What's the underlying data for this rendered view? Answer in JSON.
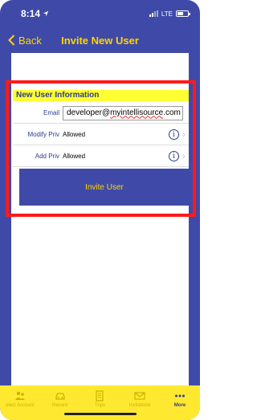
{
  "status_bar": {
    "time": "8:14",
    "network": "LTE"
  },
  "nav": {
    "back_label": "Back",
    "title": "Invite New User"
  },
  "form": {
    "section_title": "New User Information",
    "email_label": "Email",
    "email_value": "developer@myintellisource.com",
    "email_user": "developer@",
    "email_domain": "myintellisource",
    "email_tld": ".com",
    "modify_priv_label": "Modify Priv",
    "modify_priv_value": "Allowed",
    "add_priv_label": "Add Priv",
    "add_priv_value": "Allowed",
    "info_glyph": "i"
  },
  "invite_button": {
    "label": "Invite User"
  },
  "tabs": [
    {
      "label": "elect Account",
      "icon": "users-icon"
    },
    {
      "label": "Record",
      "icon": "car-icon"
    },
    {
      "label": "Trips",
      "icon": "document-icon"
    },
    {
      "label": "Invitations",
      "icon": "envelope-icon"
    },
    {
      "label": "More",
      "icon": "more-icon",
      "active": true
    }
  ],
  "colors": {
    "primary": "#3f4aa8",
    "accent": "#ffd400",
    "highlight": "#ff1a1a",
    "section": "#ffff33"
  }
}
